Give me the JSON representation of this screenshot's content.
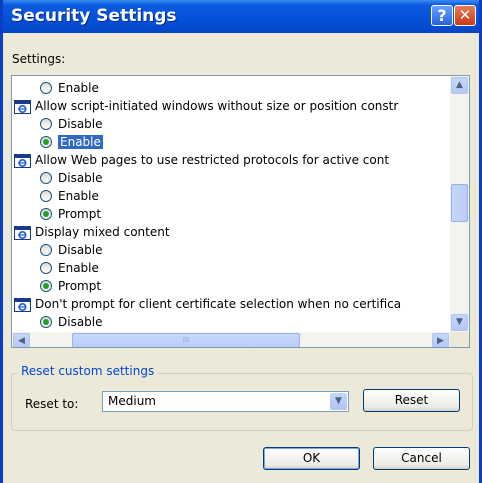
{
  "window": {
    "title": "Security Settings",
    "help_glyph": "?",
    "close_glyph": "✕"
  },
  "settings_label": "Settings:",
  "list": {
    "rows": [
      {
        "kind": "option",
        "label": "Enable",
        "checked": false
      },
      {
        "kind": "category",
        "label": "Allow script-initiated windows without size or position constr"
      },
      {
        "kind": "option",
        "label": "Disable",
        "checked": false
      },
      {
        "kind": "option",
        "label": "Enable",
        "checked": true,
        "selected": true
      },
      {
        "kind": "category",
        "label": "Allow Web pages to use restricted protocols for active cont"
      },
      {
        "kind": "option",
        "label": "Disable",
        "checked": false
      },
      {
        "kind": "option",
        "label": "Enable",
        "checked": false
      },
      {
        "kind": "option",
        "label": "Prompt",
        "checked": true
      },
      {
        "kind": "category",
        "label": "Display mixed content"
      },
      {
        "kind": "option",
        "label": "Disable",
        "checked": false
      },
      {
        "kind": "option",
        "label": "Enable",
        "checked": false
      },
      {
        "kind": "option",
        "label": "Prompt",
        "checked": true
      },
      {
        "kind": "category",
        "label": "Don't prompt for client certificate selection when no certifica"
      },
      {
        "kind": "option",
        "label": "Disable",
        "checked": true
      }
    ],
    "scroll_up": "▲",
    "scroll_down": "▼",
    "scroll_left": "◀",
    "scroll_right": "▶",
    "thumb_grip": "III"
  },
  "reset_group": {
    "legend": "Reset custom settings",
    "reset_to_label": "Reset to:",
    "level_value": "Medium",
    "dropdown_arrow": "▼",
    "reset_button": "Reset"
  },
  "buttons": {
    "ok": "OK",
    "cancel": "Cancel"
  },
  "colors": {
    "titlebar": "#0550d8",
    "selection": "#316ac5",
    "group_legend": "#0046d5"
  }
}
